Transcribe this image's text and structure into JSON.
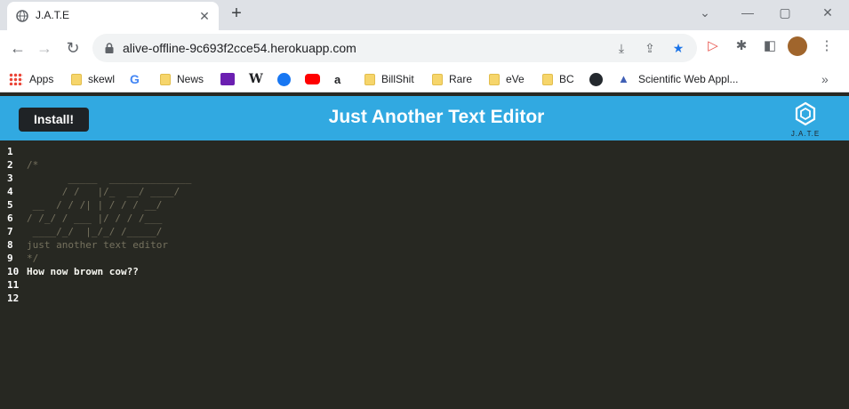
{
  "browser": {
    "tab_title": "J.A.T.E",
    "url": "alive-offline-9c693f2cce54.herokuapp.com",
    "bookmarks": [
      "Apps",
      "skewl",
      "News",
      "BillShit",
      "Rare",
      "eVe",
      "BC",
      "Scientific Web Appl..."
    ]
  },
  "app": {
    "install_label": "Install!",
    "title": "Just Another Text Editor",
    "logo_text": "J.A.T.E"
  },
  "editor": {
    "lines": [
      {
        "n": "1",
        "text": "",
        "kind": "txt"
      },
      {
        "n": "2",
        "text": "/*",
        "kind": "cmt"
      },
      {
        "n": "3",
        "text": "       _____  ______________",
        "kind": "cmt"
      },
      {
        "n": "4",
        "text": "      / /   |/_  __/ ____/",
        "kind": "cmt"
      },
      {
        "n": "5",
        "text": " __  / / /| | / / / __/",
        "kind": "cmt"
      },
      {
        "n": "6",
        "text": "/ /_/ / ___ |/ / / /___",
        "kind": "cmt"
      },
      {
        "n": "7",
        "text": " ____/_/  |_/_/ /_____/",
        "kind": "cmt"
      },
      {
        "n": "8",
        "text": "just another text editor",
        "kind": "cmt"
      },
      {
        "n": "9",
        "text": "*/",
        "kind": "cmt"
      },
      {
        "n": "10",
        "text": "How now brown cow??",
        "kind": "txt"
      },
      {
        "n": "11",
        "text": "",
        "kind": "txt"
      },
      {
        "n": "12",
        "text": "",
        "kind": "txt"
      }
    ]
  },
  "colors": {
    "header": "#31a9e1",
    "editor_bg": "#272822",
    "comment": "#75715e",
    "text": "#f8f8f2"
  }
}
